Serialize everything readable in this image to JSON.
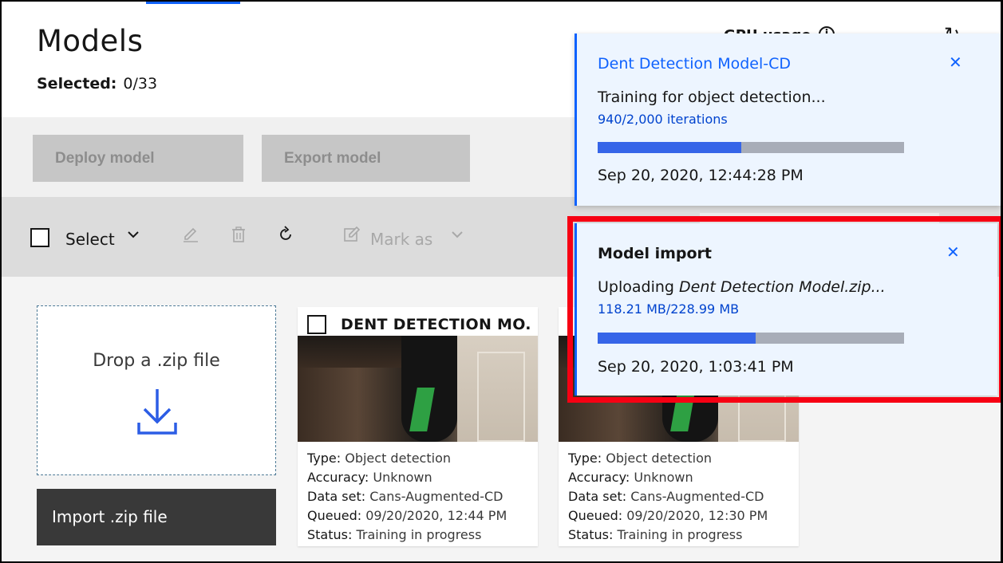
{
  "page": {
    "title": "Models",
    "selected_label": "Selected:",
    "selected_value": "0/33",
    "gpu_label": "GPU usage"
  },
  "actions": {
    "deploy_label": "Deploy model",
    "export_label": "Export model"
  },
  "toolbar": {
    "select_label": "Select",
    "mark_as_label": "Mark as",
    "icons": [
      "edit-icon",
      "trash-icon",
      "refresh-icon",
      "mark-icon",
      "chevron-down-icon"
    ]
  },
  "import": {
    "drop_text": "Drop a .zip file",
    "button_label": "Import .zip file"
  },
  "cards": [
    {
      "title": "DENT DETECTION MO...",
      "type_key": "Type:",
      "type_val": "Object detection",
      "acc_key": "Accuracy:",
      "acc_val": "Unknown",
      "ds_key": "Data set:",
      "ds_val": "Cans-Augmented-CD",
      "queued_key": "Queued:",
      "queued_val": "09/20/2020, 12:44 PM",
      "status_key": "Status:",
      "status_val": "Training in progress"
    },
    {
      "title": "",
      "type_key": "Type:",
      "type_val": "Object detection",
      "acc_key": "Accuracy:",
      "acc_val": "Unknown",
      "ds_key": "Data set:",
      "ds_val": "Cans-Augmented-CD",
      "queued_key": "Queued:",
      "queued_val": "09/20/2020, 12:30 PM",
      "status_key": "Status:",
      "status_val": "Training in progress"
    }
  ],
  "notifications": [
    {
      "title": "Dent Detection Model-CD",
      "message": "Training for object detection...",
      "sub": "940/2,000 iterations",
      "progress": 0.47,
      "time": "Sep 20, 2020, 12:44:28 PM"
    },
    {
      "title": "Model import",
      "message_prefix": "Uploading ",
      "message_file": "Dent Detection Model.zip...",
      "sub": "118.21 MB/228.99 MB",
      "progress": 0.516,
      "time": "Sep 20, 2020, 1:03:41 PM"
    }
  ],
  "colors": {
    "accent": "#0f62fe",
    "highlight": "#f70013",
    "progress_fill": "#3665e8",
    "notification_bg": "#edf5ff"
  }
}
